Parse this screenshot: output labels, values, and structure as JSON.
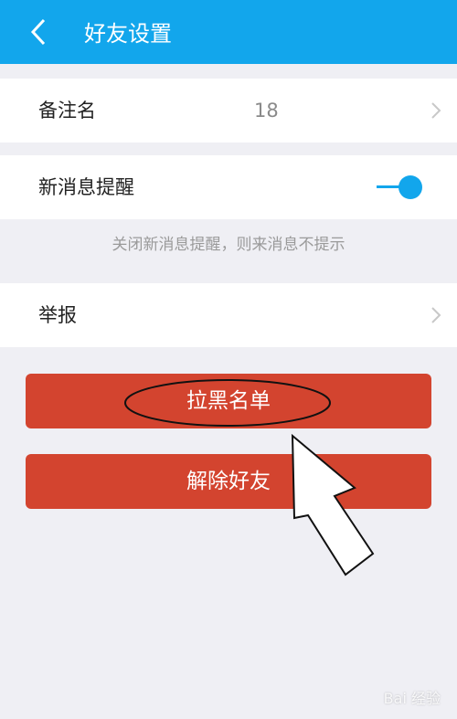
{
  "header": {
    "title": "好友设置",
    "back_icon": "back-arrow-icon"
  },
  "rows": {
    "remark": {
      "label": "备注名",
      "value": "18"
    },
    "notify": {
      "label": "新消息提醒",
      "enabled": true
    },
    "report": {
      "label": "举报"
    }
  },
  "hint": "关闭新消息提醒，则来消息不提示",
  "buttons": {
    "blacklist": "拉黑名单",
    "unfriend": "解除好友"
  },
  "watermark": "Bai 经验",
  "colors": {
    "accent": "#12a6ec",
    "danger": "#d3442f",
    "background": "#efeff4"
  }
}
